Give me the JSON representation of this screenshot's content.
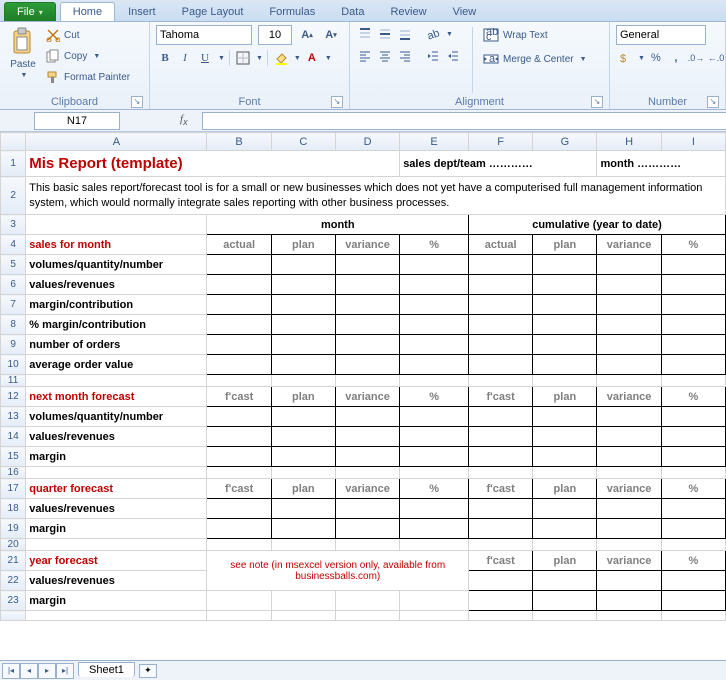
{
  "tabs": {
    "file": "File",
    "home": "Home",
    "insert": "Insert",
    "pagelayout": "Page Layout",
    "formulas": "Formulas",
    "data": "Data",
    "review": "Review",
    "view": "View"
  },
  "ribbon": {
    "paste": "Paste",
    "cut": "Cut",
    "copy": "Copy",
    "formatpainter": "Format Painter",
    "clipboard": "Clipboard",
    "fontname": "Tahoma",
    "fontsize": "10",
    "font": "Font",
    "wrap": "Wrap Text",
    "merge": "Merge & Center",
    "alignment": "Alignment",
    "numfmt": "General",
    "number": "Number"
  },
  "namebox": "N17",
  "colhdrs": [
    "A",
    "B",
    "C",
    "D",
    "E",
    "F",
    "G",
    "H",
    "I"
  ],
  "rows": {
    "1": {
      "title": "Mis Report (template)",
      "sales": "sales dept/team …………",
      "month": "month …………"
    },
    "2": "This basic sales report/forecast tool is for a small or new businesses which does not yet have a computerised full management information system, which would normally integrate sales reporting with other business processes.",
    "3": {
      "m": "month",
      "c": "cumulative (year to date)"
    },
    "4": {
      "a": "sales for month",
      "h": [
        "actual",
        "plan",
        "variance",
        "%",
        "actual",
        "plan",
        "variance",
        "%"
      ]
    },
    "5": "volumes/quantity/number",
    "6": "values/revenues",
    "7": "margin/contribution",
    "8": "% margin/contribution",
    "9": "number of orders",
    "10": "average order value",
    "12": {
      "a": "next month forecast",
      "h": [
        "f'cast",
        "plan",
        "variance",
        "%",
        "f'cast",
        "plan",
        "variance",
        "%"
      ]
    },
    "13": "volumes/quantity/number",
    "14": "values/revenues",
    "15": "margin",
    "17": {
      "a": "quarter forecast",
      "h": [
        "f'cast",
        "plan",
        "variance",
        "%",
        "f'cast",
        "plan",
        "variance",
        "%"
      ]
    },
    "18": "values/revenues",
    "19": "margin",
    "21": {
      "a": "year forecast",
      "h": [
        "f'cast",
        "plan",
        "variance",
        "%"
      ]
    },
    "note": "see note (in msexcel version only, available from businessballs.com)",
    "22": "values/revenues",
    "23": "margin"
  },
  "sheettab": "Sheet1"
}
